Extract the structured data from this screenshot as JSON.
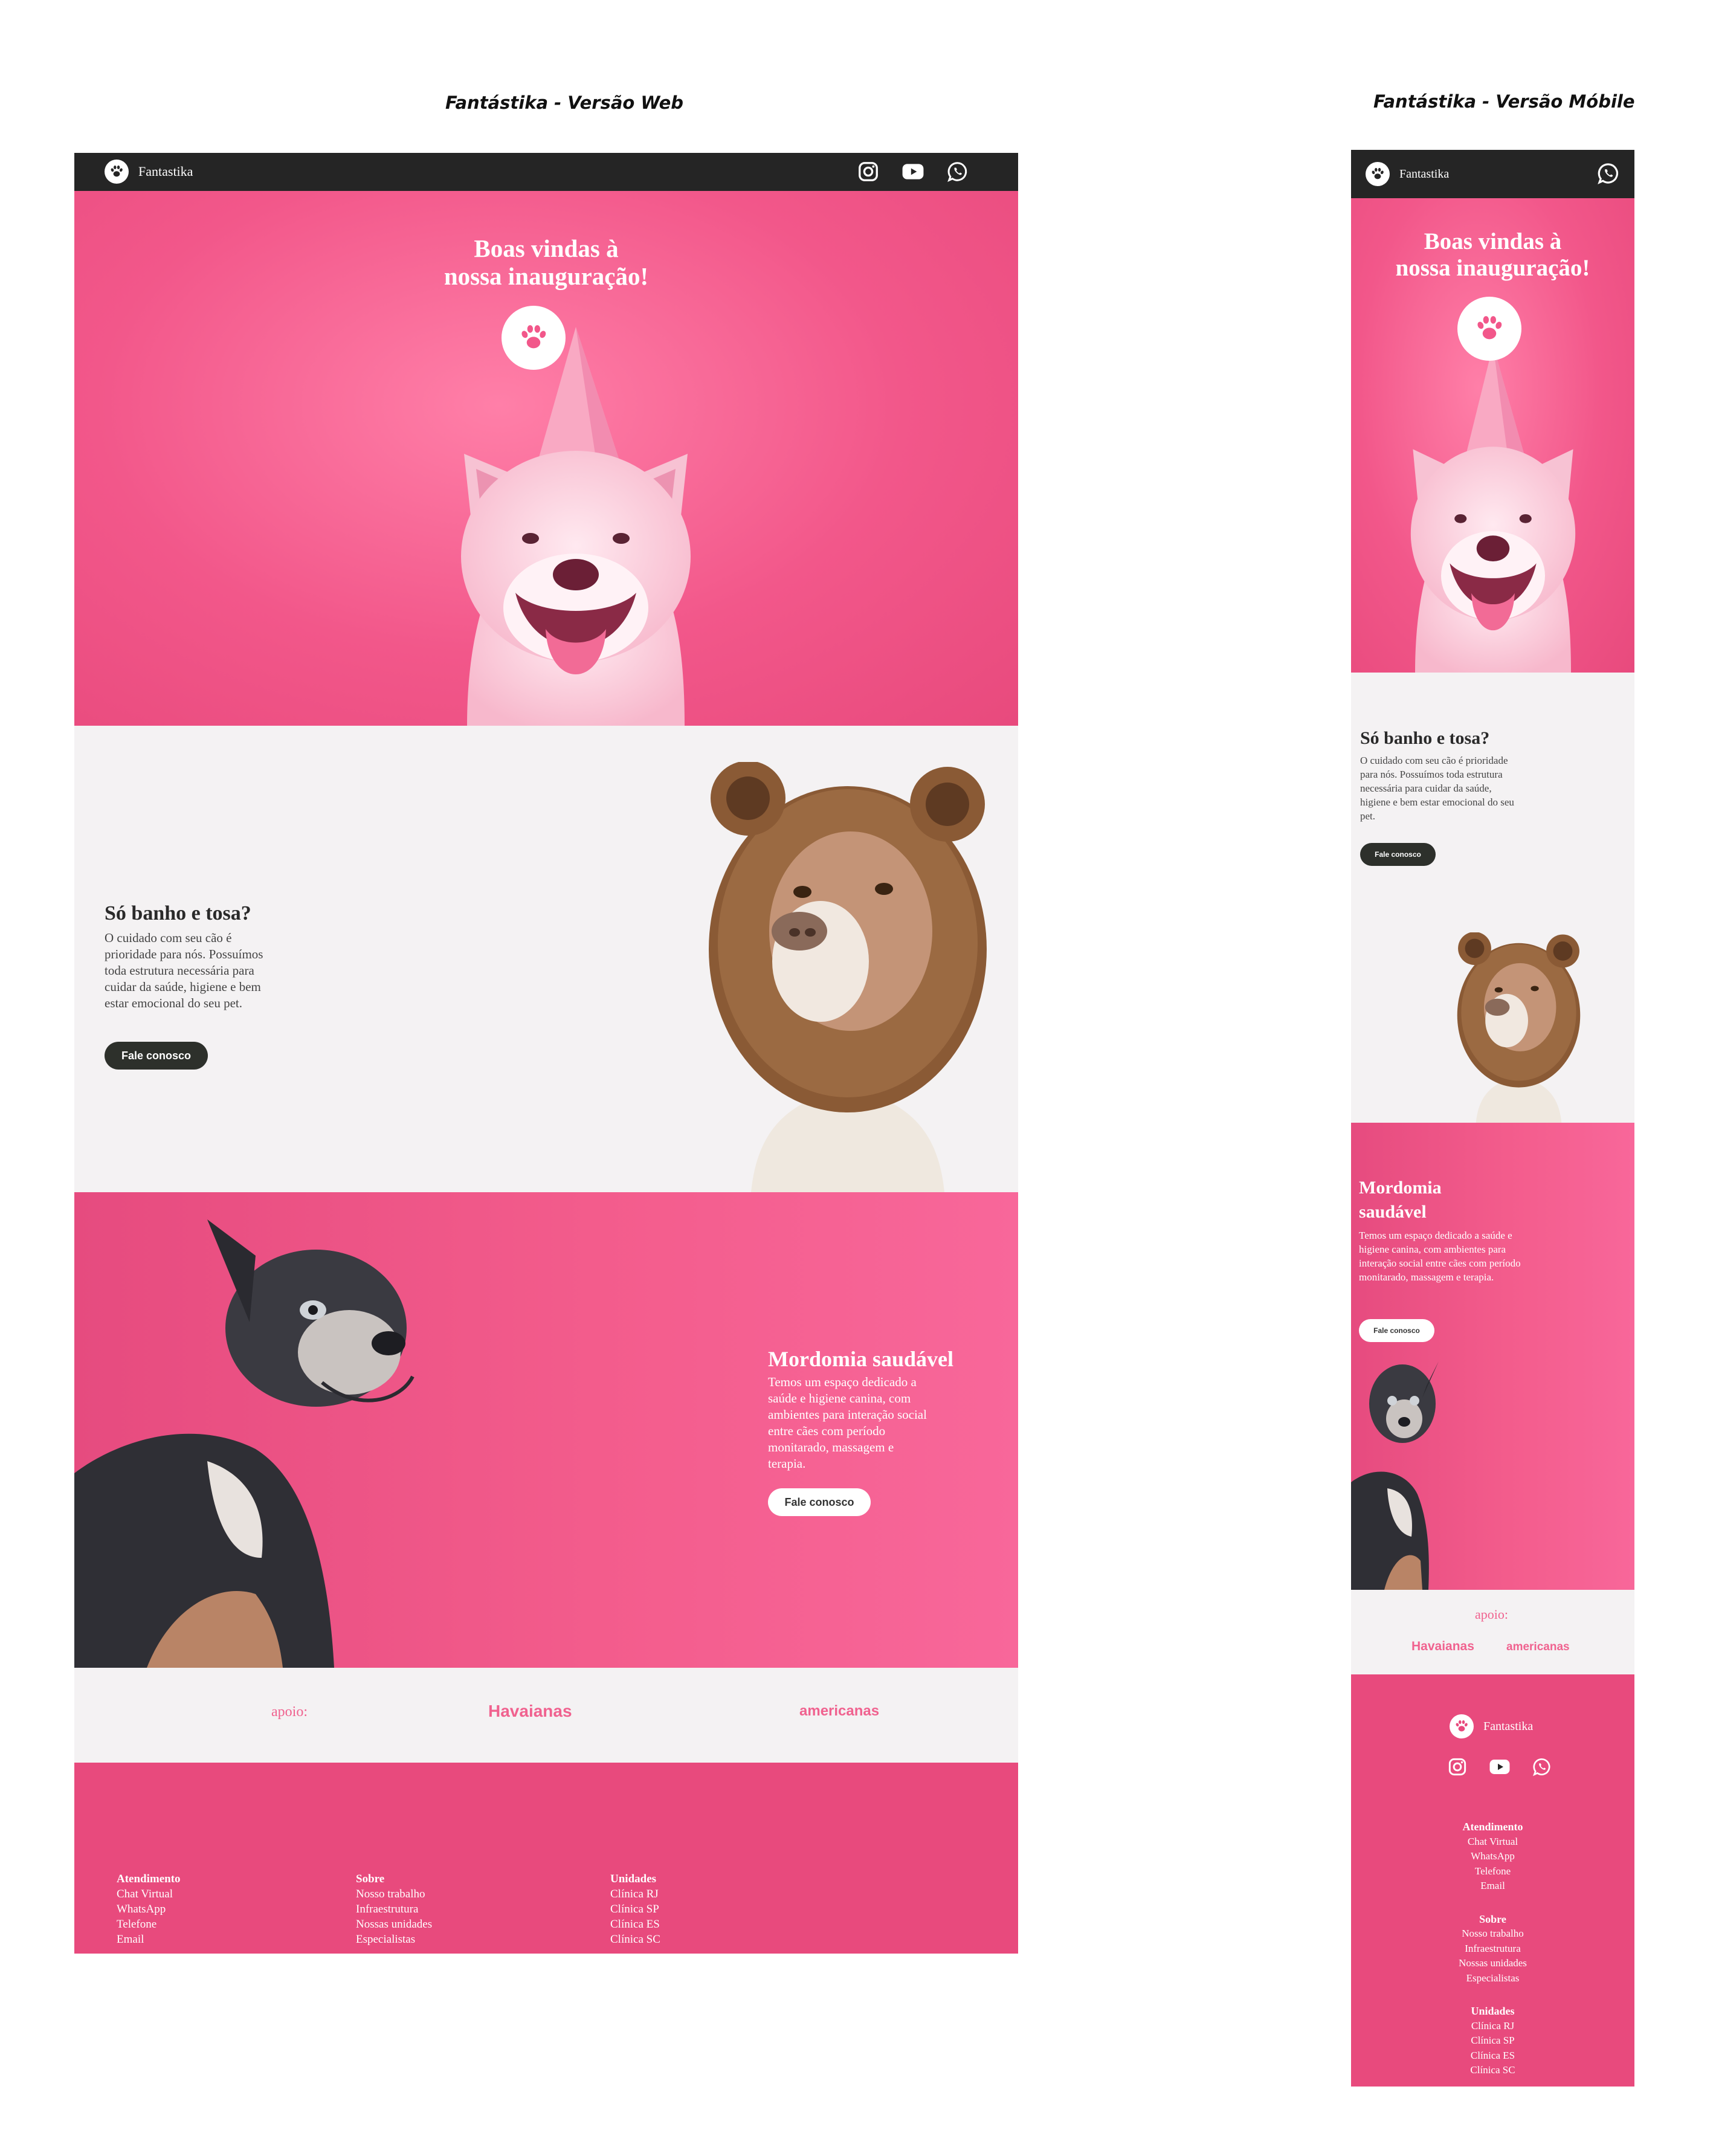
{
  "captions": {
    "web": "Fantástika - Versão Web",
    "mobile": "Fantástika - Versão Móbile"
  },
  "brand": {
    "name": "Fantastika"
  },
  "icons": [
    "paw-icon",
    "instagram-icon",
    "youtube-icon",
    "whatsapp-icon"
  ],
  "colors": {
    "pink": "#f2578a",
    "footer_pink": "#e84a7d",
    "dark": "#252525",
    "light_bg": "#f4f2f3",
    "button_dark": "#2d302b"
  },
  "hero": {
    "title_line1": "Boas vindas à",
    "title_line2": "nossa inauguração!"
  },
  "grooming": {
    "title": "Só banho e tosa?",
    "text": "O cuidado com seu cão é prioridade para nós. Possuímos toda estrutura necessária para cuidar da saúde, higiene e bem estar emocional do seu pet.",
    "button": "Fale conosco"
  },
  "wellness": {
    "title": "Mordomia saudável",
    "text": "Temos um espaço dedicado a saúde e higiene canina, com ambientes para interação social entre cães com período monitarado, massagem e terapia.",
    "button": "Fale conosco"
  },
  "support": {
    "label": "apoio:",
    "sponsors": [
      "Havaianas",
      "americanas"
    ]
  },
  "footer": {
    "columns": [
      {
        "title": "Atendimento",
        "items": [
          "Chat Virtual",
          "WhatsApp",
          "Telefone",
          "Email"
        ]
      },
      {
        "title": "Sobre",
        "items": [
          "Nosso trabalho",
          "Infraestrutura",
          "Nossas unidades",
          "Especialistas"
        ]
      },
      {
        "title": "Unidades",
        "items": [
          "Clínica RJ",
          "Clínica SP",
          "Clínica ES",
          "Clínica SC"
        ]
      }
    ]
  }
}
